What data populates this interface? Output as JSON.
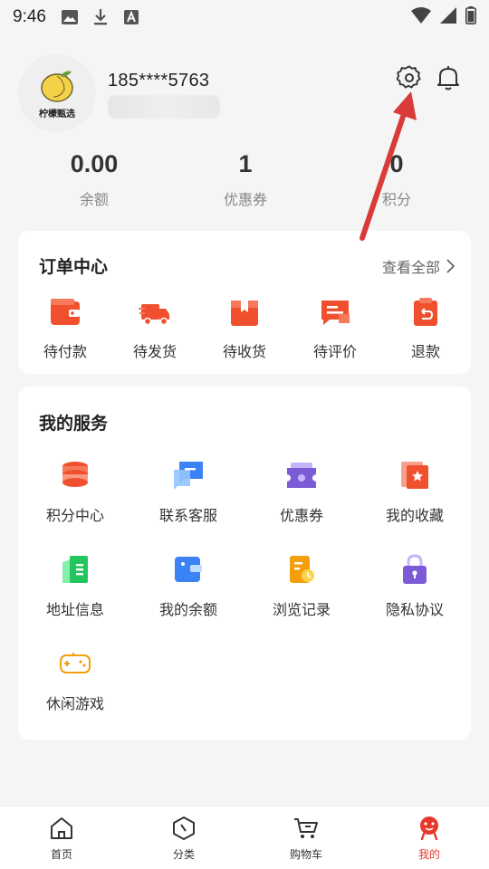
{
  "status_bar": {
    "time": "9:46"
  },
  "profile": {
    "brand_name": "柠檬甄选",
    "phone": "185****5763"
  },
  "stats": [
    {
      "value": "0.00",
      "label": "余额"
    },
    {
      "value": "1",
      "label": "优惠券"
    },
    {
      "value": "0",
      "label": "积分"
    }
  ],
  "orders": {
    "title": "订单中心",
    "view_all": "查看全部",
    "items": [
      {
        "label": "待付款",
        "icon": "wallet-icon"
      },
      {
        "label": "待发货",
        "icon": "truck-icon"
      },
      {
        "label": "待收货",
        "icon": "box-icon"
      },
      {
        "label": "待评价",
        "icon": "comment-icon"
      },
      {
        "label": "退款",
        "icon": "refund-icon"
      }
    ]
  },
  "services": {
    "title": "我的服务",
    "items": [
      {
        "label": "积分中心",
        "icon": "points-icon"
      },
      {
        "label": "联系客服",
        "icon": "chat-icon"
      },
      {
        "label": "优惠券",
        "icon": "coupon-icon"
      },
      {
        "label": "我的收藏",
        "icon": "favorites-icon"
      },
      {
        "label": "地址信息",
        "icon": "address-icon"
      },
      {
        "label": "我的余额",
        "icon": "balance-icon"
      },
      {
        "label": "浏览记录",
        "icon": "history-icon"
      },
      {
        "label": "隐私协议",
        "icon": "lock-icon"
      },
      {
        "label": "休闲游戏",
        "icon": "gamepad-icon"
      }
    ]
  },
  "tabbar": {
    "items": [
      {
        "label": "首页",
        "icon": "home-icon"
      },
      {
        "label": "分类",
        "icon": "category-icon"
      },
      {
        "label": "购物车",
        "icon": "cart-icon"
      },
      {
        "label": "我的",
        "icon": "profile-icon"
      }
    ],
    "active_index": 3
  },
  "colors": {
    "accent": "#e8382c",
    "annotation": "#d93a3a"
  }
}
